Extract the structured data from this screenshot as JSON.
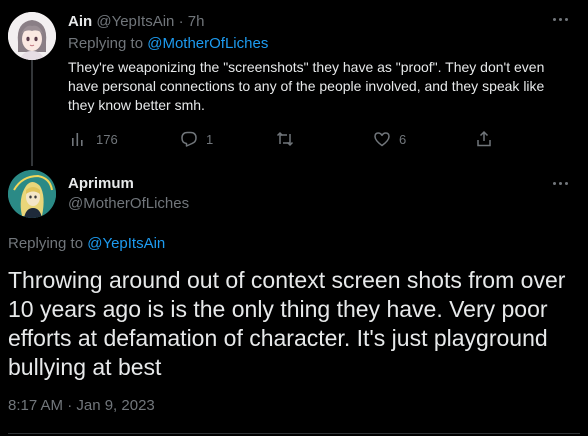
{
  "parent_tweet": {
    "author_name": "Ain",
    "author_handle": "@YepItsAin",
    "separator": "·",
    "time": "7h",
    "replying_prefix": "Replying to ",
    "replying_to": "@MotherOfLiches",
    "text": "They're weaponizing the \"screenshots\" they have as \"proof\". They don't even have personal connections to any of the people involved, and they speak like they know better smh.",
    "avatar_icon": "anime-avatar-icon",
    "actions": {
      "views": "176",
      "replies": "1",
      "retweets": "",
      "likes": "6"
    }
  },
  "main_tweet": {
    "author_name": "Aprimum",
    "author_handle": "@MotherOfLiches",
    "replying_prefix": "Replying to ",
    "replying_to": "@YepItsAin",
    "text": "Throwing around out of context screen shots from over 10 years ago is is the only thing they have. Very poor efforts at defamation of character. It's just playground bullying at best",
    "timestamp": "8:17 AM · Jan 9, 2023",
    "avatar_icon": "illustrated-avatar-icon"
  },
  "colors": {
    "background": "#000000",
    "text_primary": "#e7e9ea",
    "text_secondary": "#71767b",
    "link": "#1d9bf0",
    "divider": "#2f3336"
  }
}
